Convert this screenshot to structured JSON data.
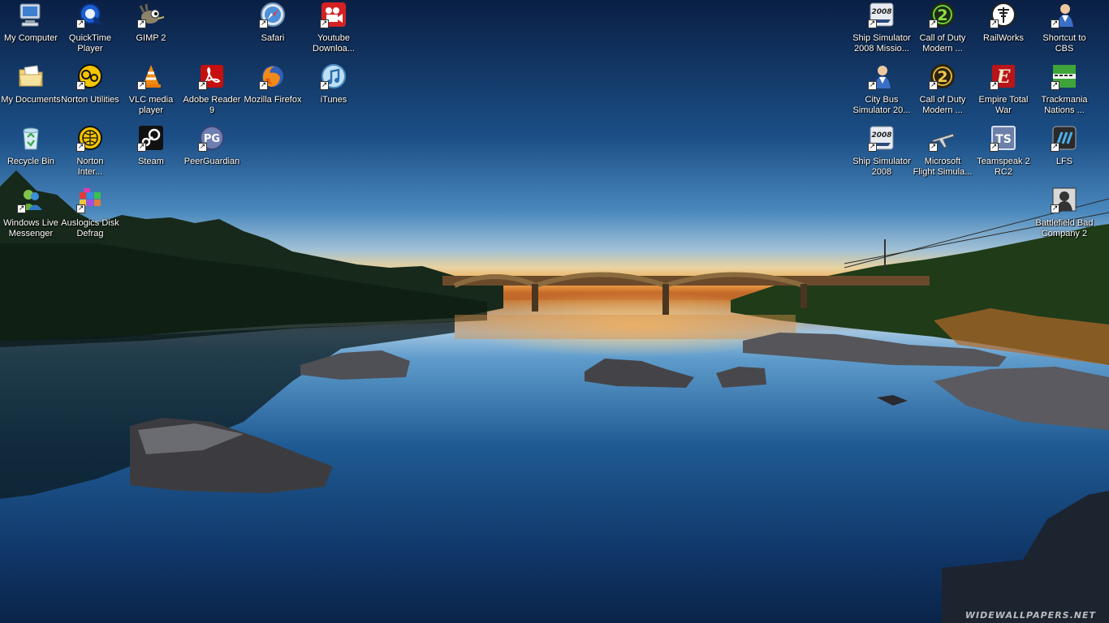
{
  "desktop": {
    "icons": [
      {
        "label": "My Computer",
        "icon": "computer-icon",
        "shortcut": false
      },
      {
        "label": "QuickTime\nPlayer",
        "icon": "quicktime-icon",
        "shortcut": true
      },
      {
        "label": "GIMP 2",
        "icon": "gimp-icon",
        "shortcut": true
      },
      {
        "label": "Safari",
        "icon": "safari-icon",
        "shortcut": true
      },
      {
        "label": "Youtube\nDownloa...",
        "icon": "youtube-downloader-icon",
        "shortcut": true
      },
      {
        "label": "My Documents",
        "icon": "documents-folder-icon",
        "shortcut": false
      },
      {
        "label": "Norton Utilities",
        "icon": "norton-utilities-icon",
        "shortcut": true
      },
      {
        "label": "VLC media\nplayer",
        "icon": "vlc-icon",
        "shortcut": true
      },
      {
        "label": "Adobe Reader\n9",
        "icon": "adobe-reader-icon",
        "shortcut": true
      },
      {
        "label": "Mozilla Firefox",
        "icon": "firefox-icon",
        "shortcut": true
      },
      {
        "label": "iTunes",
        "icon": "itunes-icon",
        "shortcut": true
      },
      {
        "label": "Recycle Bin",
        "icon": "recycle-bin-icon",
        "shortcut": false
      },
      {
        "label": "Norton\nInter...",
        "icon": "norton-internet-icon",
        "shortcut": true
      },
      {
        "label": "Steam",
        "icon": "steam-icon",
        "shortcut": true
      },
      {
        "label": "PeerGuardian",
        "icon": "peerguardian-icon",
        "shortcut": true
      },
      {
        "label": "Windows Live\nMessenger",
        "icon": "messenger-icon",
        "shortcut": true
      },
      {
        "label": "Auslogics Disk\nDefrag",
        "icon": "defrag-icon",
        "shortcut": true
      },
      {
        "label": "Ship Simulator\n2008 Missio...",
        "icon": "ship-simulator-icon",
        "shortcut": true
      },
      {
        "label": "Call of Duty\nModern ...",
        "icon": "call-of-duty-icon",
        "shortcut": true
      },
      {
        "label": "RailWorks",
        "icon": "railworks-icon",
        "shortcut": true
      },
      {
        "label": "Shortcut to\nCBS",
        "icon": "user-icon",
        "shortcut": true
      },
      {
        "label": "City Bus\nSimulator 20...",
        "icon": "user-icon",
        "shortcut": true
      },
      {
        "label": "Call of Duty\nModern ...",
        "icon": "call-of-duty-icon",
        "shortcut": true
      },
      {
        "label": "Empire Total\nWar",
        "icon": "empire-total-war-icon",
        "shortcut": true
      },
      {
        "label": "Trackmania\nNations ...",
        "icon": "trackmania-icon",
        "shortcut": true
      },
      {
        "label": "Ship Simulator\n2008",
        "icon": "ship-simulator-icon",
        "shortcut": true
      },
      {
        "label": "Microsoft\nFlight Simula...",
        "icon": "flight-simulator-icon",
        "shortcut": true
      },
      {
        "label": "Teamspeak 2\nRC2",
        "icon": "teamspeak-icon",
        "shortcut": true
      },
      {
        "label": "LFS",
        "icon": "lfs-icon",
        "shortcut": true
      },
      {
        "label": "Battlefield Bad\nCompany 2",
        "icon": "battlefield-icon",
        "shortcut": true
      }
    ],
    "badge_text": {
      "ship": "2008",
      "cod": "2",
      "empire": "E",
      "teamspeak": "TS",
      "peerguardian": "PG"
    }
  },
  "wallpaper": {
    "watermark": "WIDEWALLPAPERS.NET"
  }
}
